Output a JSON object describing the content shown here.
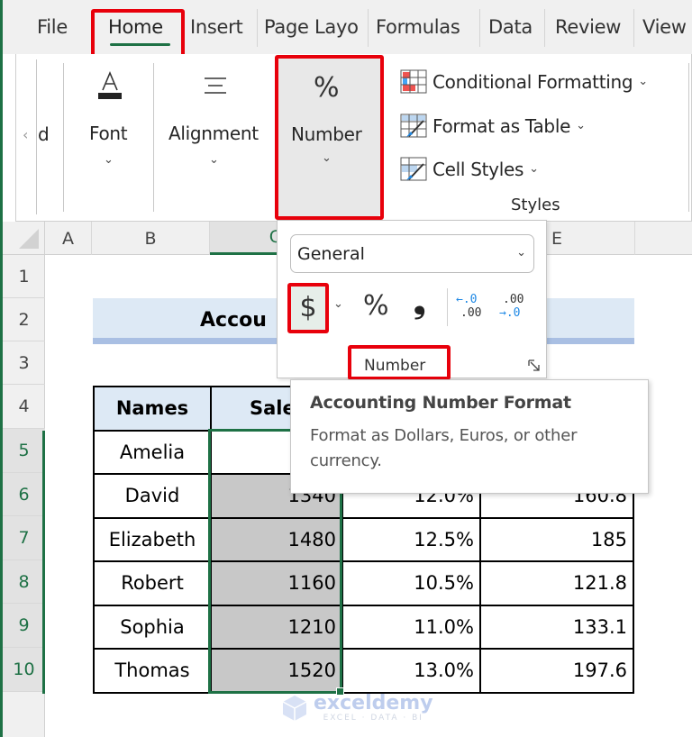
{
  "tabs": [
    {
      "label": "File"
    },
    {
      "label": "Home",
      "active": true
    },
    {
      "label": "Insert"
    },
    {
      "label": "Page Layo"
    },
    {
      "label": "Formulas"
    },
    {
      "label": "Data"
    },
    {
      "label": "Review"
    },
    {
      "label": "View"
    }
  ],
  "ribbon": {
    "scroll_left_glyph": "‹",
    "clipped_group_label": "d",
    "groups": [
      {
        "label": "Font",
        "icon": "font-color-icon"
      },
      {
        "label": "Alignment",
        "icon": "align-center-icon"
      },
      {
        "label": "Number",
        "icon": "percent-icon",
        "icon_glyph": "%"
      }
    ],
    "styles": {
      "items": [
        {
          "label": "Conditional Formatting"
        },
        {
          "label": "Format as Table"
        },
        {
          "label": "Cell Styles"
        }
      ],
      "group_label": "Styles"
    }
  },
  "number_panel": {
    "format_value": "General",
    "dollar_glyph": "$",
    "percent_glyph": "%",
    "comma_glyph": "❟",
    "increase_decimal": {
      "top": "←.0",
      "bottom": ".00"
    },
    "decrease_decimal": {
      "top": ".00",
      "bottom": "→.0"
    },
    "group_label": "Number"
  },
  "tooltip": {
    "title": "Accounting Number Format",
    "body": "Format as Dollars, Euros, or other currency."
  },
  "sheet": {
    "columns": [
      "A",
      "B",
      "C",
      "",
      "E"
    ],
    "rows": [
      "1",
      "2",
      "3",
      "4",
      "5",
      "6",
      "7",
      "8",
      "9",
      "10"
    ],
    "title": "Accou",
    "headers": [
      "Names",
      "Sale",
      "",
      ""
    ],
    "data": [
      {
        "name": "Amelia",
        "sales": "",
        "pct": "",
        "comm": ""
      },
      {
        "name": "David",
        "sales": "1340",
        "pct": "12.0%",
        "comm": "160.8"
      },
      {
        "name": "Elizabeth",
        "sales": "1480",
        "pct": "12.5%",
        "comm": "185"
      },
      {
        "name": "Robert",
        "sales": "1160",
        "pct": "10.5%",
        "comm": "121.8"
      },
      {
        "name": "Sophia",
        "sales": "1210",
        "pct": "11.0%",
        "comm": "133.1"
      },
      {
        "name": "Thomas",
        "sales": "1520",
        "pct": "13.0%",
        "comm": "197.6"
      }
    ]
  },
  "watermark": {
    "name": "exceldemy",
    "tagline": "EXCEL · DATA · BI"
  },
  "colors": {
    "accent_green": "#1e7145",
    "highlight_red": "#e8000b",
    "header_fill": "#dde9f5"
  }
}
